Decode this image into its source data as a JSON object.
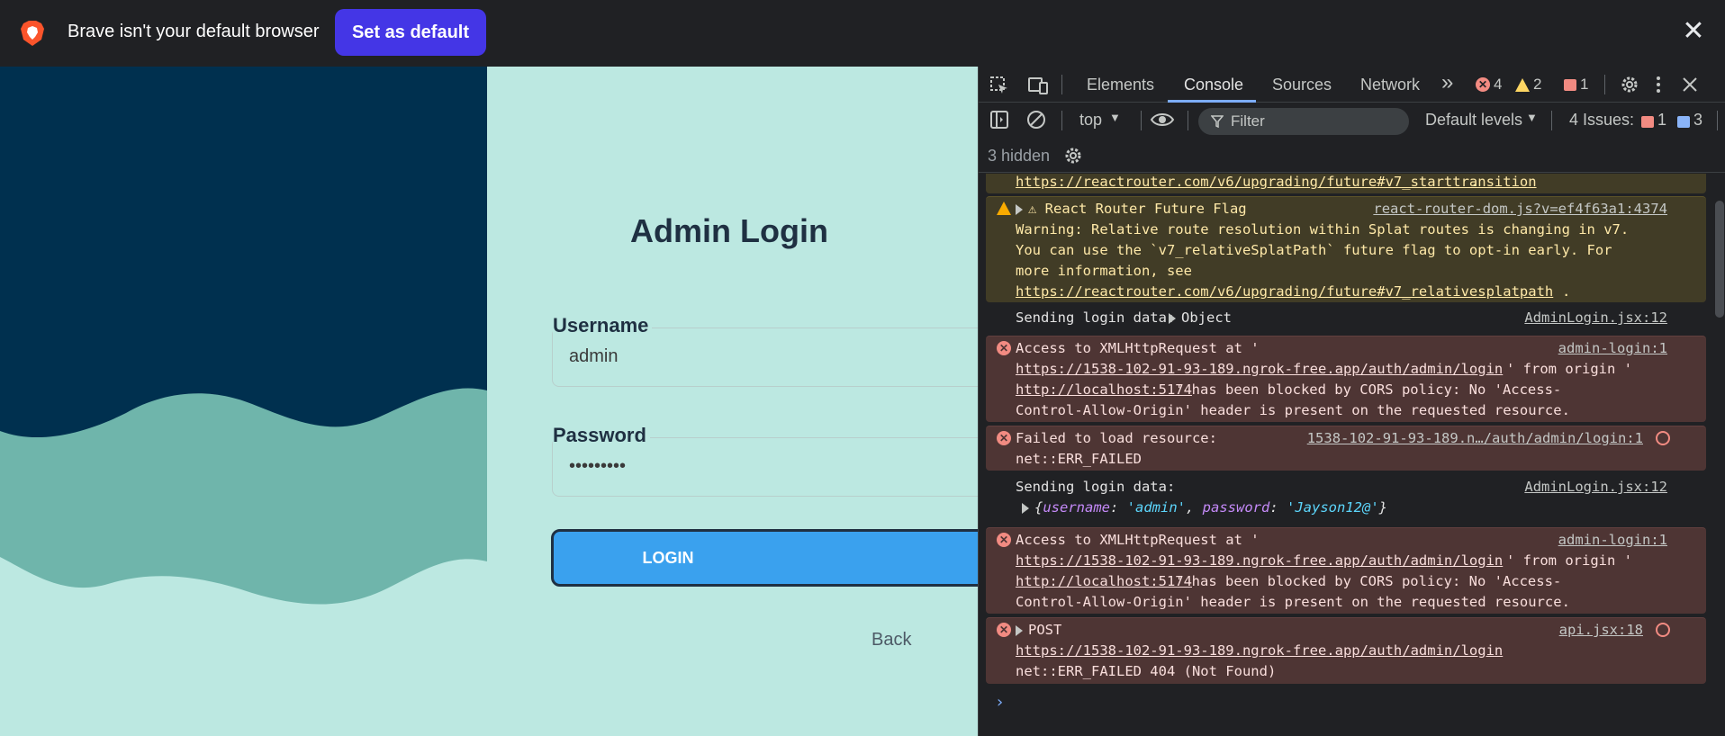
{
  "infobar": {
    "message": "Brave isn't your default browser",
    "set_default_label": "Set as default",
    "close_glyph": "✕"
  },
  "page": {
    "title": "Admin Login",
    "username_label": "Username",
    "username_value": "admin",
    "password_label": "Password",
    "password_value": "•••••••••",
    "login_label": "LOGIN",
    "back_label": "Back",
    "colors": {
      "background": "#bce8e1",
      "navy": "#00304f",
      "teal": "#6fb5ab",
      "button": "#3aa1ee"
    }
  },
  "devtools": {
    "tabs": [
      "Elements",
      "Console",
      "Sources",
      "Network"
    ],
    "active_tab": "Console",
    "more_tabs_glyph": "»",
    "error_count": "4",
    "warning_count": "2",
    "flag_count": "1",
    "context": "top",
    "filter_placeholder": "Filter",
    "levels": "Default levels",
    "issues_label": "4 Issues:",
    "issues_error_count": "1",
    "issues_info_count": "3",
    "hidden_label": "3 hidden"
  },
  "console": {
    "top_link": "https://reactrouter.com/v6/upgrading/future#v7_starttransition",
    "warn_title": "React Router Future Flag",
    "warn_src": "react-router-dom.js?v=ef4f63a1:4374",
    "warn_line1": "Warning: Relative route resolution within Splat routes is changing in v7.",
    "warn_line2": "You can use the `v7_relativeSplatPath` future flag to opt-in early. For",
    "warn_line3": "more information, see",
    "warn_link": "https://reactrouter.com/v6/upgrading/future#v7_relativesplatpath",
    "info1_text": "Sending login data:",
    "info1_obj": "Object",
    "info1_src": "AdminLogin.jsx:12",
    "cors1_l1": "Access to XMLHttpRequest at '",
    "cors_src": "admin-login:1",
    "cors_url": "https://1538-102-91-93-189.ngrok-free.app/auth/admin/login",
    "cors_from": "' from origin '",
    "cors_origin": "http://localhost:5174",
    "cors_blocked": "' has been blocked by CORS policy: No 'Access-",
    "cors_l4": "Control-Allow-Origin' header is present on the requested resource.",
    "fail_l1": "Failed to load resource:",
    "fail_src": "1538-102-91-93-189.n…/auth/admin/login:1",
    "fail_l2": "net::ERR_FAILED",
    "info2_text": "Sending login data:",
    "info2_src": "AdminLogin.jsx:12",
    "info2_obj_open": "{",
    "info2_key1": "username",
    "info2_val1": "'admin'",
    "info2_sep": ", ",
    "info2_key2": "password",
    "info2_val2": "'Jayson12@'",
    "info2_obj_close": "}",
    "post_label": "POST",
    "post_src": "api.jsx:18",
    "post_url": "https://1538-102-91-93-189.ngrok-free.app/auth/admin/login",
    "post_l3": "net::ERR_FAILED 404 (Not Found)",
    "prompt": "›"
  }
}
